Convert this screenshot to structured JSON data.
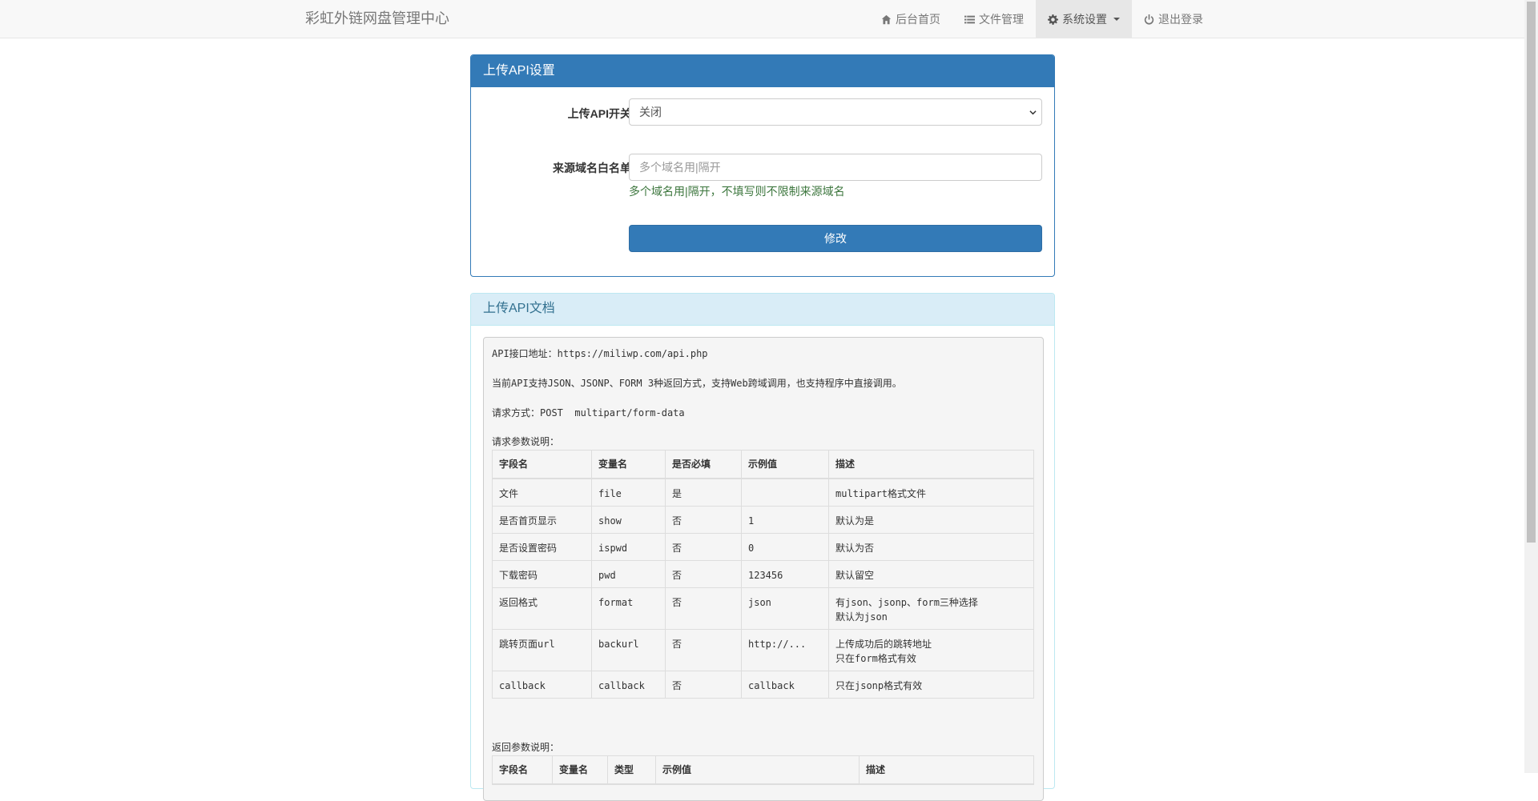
{
  "navbar": {
    "brand": "彩虹外链网盘管理中心",
    "items": [
      {
        "label": "后台首页",
        "icon": "home-icon"
      },
      {
        "label": "文件管理",
        "icon": "list-icon"
      },
      {
        "label": "系统设置",
        "icon": "gear-icon"
      },
      {
        "label": "退出登录",
        "icon": "power-icon"
      }
    ]
  },
  "settings_panel": {
    "title": "上传API设置",
    "switch_label": "上传API开关",
    "switch_value": "关闭",
    "whitelist_label": "来源域名白名单",
    "whitelist_placeholder": "多个域名用|隔开",
    "whitelist_help": "多个域名用|隔开，不填写则不限制来源域名",
    "submit_label": "修改"
  },
  "doc_panel": {
    "title": "上传API文档",
    "api_url_line": "API接口地址：https://miliwp.com/api.php",
    "support_line": "当前API支持JSON、JSONP、FORM 3种返回方式，支持Web跨域调用，也支持程序中直接调用。",
    "method_line": "请求方式：POST  multipart/form-data",
    "request_params_title": "请求参数说明：",
    "request_headers": [
      "字段名",
      "变量名",
      "是否必填",
      "示例值",
      "描述"
    ],
    "request_rows": [
      [
        "文件",
        "file",
        "是",
        "",
        "multipart格式文件"
      ],
      [
        "是否首页显示",
        "show",
        "否",
        "1",
        "默认为是"
      ],
      [
        "是否设置密码",
        "ispwd",
        "否",
        "0",
        "默认为否"
      ],
      [
        "下载密码",
        "pwd",
        "否",
        "123456",
        "默认留空"
      ],
      [
        "返回格式",
        "format",
        "否",
        "json",
        "有json、jsonp、form三种选择\n默认为json"
      ],
      [
        "跳转页面url",
        "backurl",
        "否",
        "http://...",
        "上传成功后的跳转地址\n只在form格式有效"
      ],
      [
        "callback",
        "callback",
        "否",
        "callback",
        "只在jsonp格式有效"
      ]
    ],
    "response_params_title": "返回参数说明：",
    "response_headers": [
      "字段名",
      "变量名",
      "类型",
      "示例值",
      "描述"
    ]
  }
}
